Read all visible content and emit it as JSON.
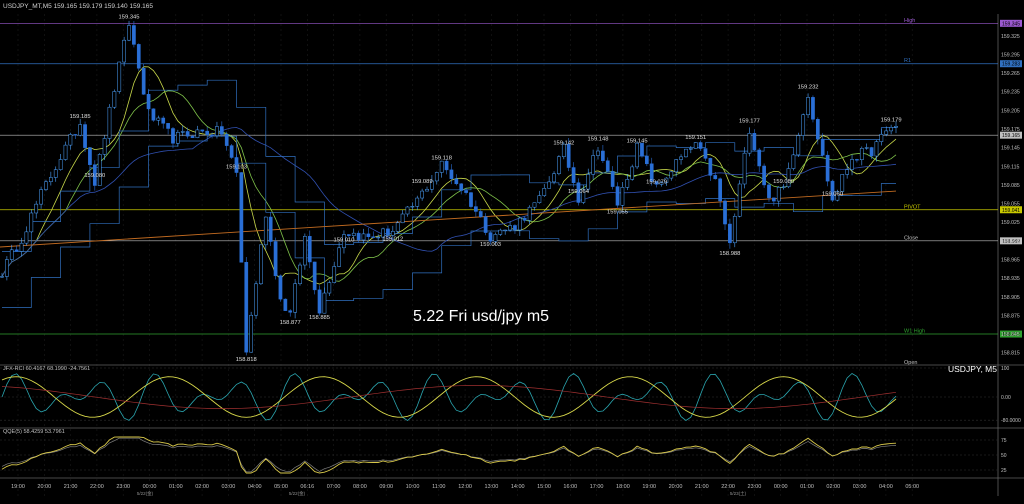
{
  "header": {
    "symbol_info": "USDJPY_MT,M5  159.165 159.179 159.140 159.165"
  },
  "overlay_title": "5.22 Fri usd/jpy m5",
  "colors": {
    "background": "#000000",
    "bull": "#4da3ff",
    "bear": "#2a6fd6",
    "ma_green": "#7fc24a",
    "ma_yellow": "#c8d84a",
    "ma_blue": "#3050b0",
    "trend_orange": "#c06a20",
    "level_purple": "#9b59d0",
    "level_blue": "#3070c0",
    "level_yellow": "#c8c800",
    "level_green": "#2fa02f",
    "level_white": "#c0c0c0",
    "osc_yellow": "#d8d84a",
    "osc_cyan": "#2aa6b0",
    "osc_red": "#a03030",
    "qqe_yellow": "#d8c84a",
    "qqe_gray": "#808080"
  },
  "chart_data": {
    "type": "candlestick",
    "symbol": "USDJPY",
    "timeframe": "M5",
    "ylim": [
      158.8,
      159.36
    ],
    "y_ticks": [
      "159.325",
      "159.295",
      "159.265",
      "159.235",
      "159.205",
      "159.175",
      "159.145",
      "159.115",
      "159.085",
      "159.055",
      "159.025",
      "158.995",
      "158.965",
      "158.935",
      "158.905",
      "158.875",
      "158.845",
      "158.815"
    ],
    "x_ticks": [
      "19:00",
      "20:00",
      "21:00",
      "22:00",
      "23:00",
      "00:00",
      "01:00",
      "02:00",
      "03:00",
      "04:00",
      "05:00",
      "06:16",
      "07:00",
      "08:00",
      "09:00",
      "10:00",
      "11:00",
      "12:00",
      "13:00",
      "14:00",
      "15:00",
      "16:00",
      "17:00",
      "18:00",
      "19:00",
      "20:00",
      "21:00",
      "22:00",
      "23:00",
      "00:00",
      "01:00",
      "02:00",
      "03:00",
      "04:00",
      "05:00"
    ],
    "date_labels": [
      "5/22(金)",
      "5/22(金)",
      "5/23(土)"
    ],
    "price_anchors": [
      {
        "t": 0,
        "p": 158.945
      },
      {
        "t": 4,
        "p": 159.0
      },
      {
        "t": 8,
        "p": 159.07
      },
      {
        "t": 12,
        "p": 159.13
      },
      {
        "t": 16,
        "p": 159.185
      },
      {
        "t": 19,
        "p": 159.09
      },
      {
        "t": 23,
        "p": 159.24
      },
      {
        "t": 26,
        "p": 159.345
      },
      {
        "t": 30,
        "p": 159.2
      },
      {
        "t": 35,
        "p": 159.16
      },
      {
        "t": 40,
        "p": 159.17
      },
      {
        "t": 45,
        "p": 159.17
      },
      {
        "t": 48,
        "p": 159.103
      },
      {
        "t": 50,
        "p": 158.818
      },
      {
        "t": 54,
        "p": 159.04
      },
      {
        "t": 57,
        "p": 158.9
      },
      {
        "t": 59,
        "p": 158.877
      },
      {
        "t": 62,
        "p": 159.0
      },
      {
        "t": 65,
        "p": 158.885
      },
      {
        "t": 70,
        "p": 159.01
      },
      {
        "t": 75,
        "p": 159.0
      },
      {
        "t": 80,
        "p": 159.012
      },
      {
        "t": 85,
        "p": 159.06
      },
      {
        "t": 90,
        "p": 159.118
      },
      {
        "t": 95,
        "p": 159.07
      },
      {
        "t": 100,
        "p": 159.003
      },
      {
        "t": 105,
        "p": 159.02
      },
      {
        "t": 110,
        "p": 159.06
      },
      {
        "t": 115,
        "p": 159.142
      },
      {
        "t": 118,
        "p": 159.064
      },
      {
        "t": 122,
        "p": 159.148
      },
      {
        "t": 126,
        "p": 159.055
      },
      {
        "t": 130,
        "p": 159.145
      },
      {
        "t": 134,
        "p": 159.079
      },
      {
        "t": 138,
        "p": 159.12
      },
      {
        "t": 142,
        "p": 159.151
      },
      {
        "t": 146,
        "p": 159.09
      },
      {
        "t": 149,
        "p": 158.988
      },
      {
        "t": 153,
        "p": 159.177
      },
      {
        "t": 157,
        "p": 159.06
      },
      {
        "t": 160,
        "p": 159.08
      },
      {
        "t": 165,
        "p": 159.232
      },
      {
        "t": 170,
        "p": 159.06
      },
      {
        "t": 174,
        "p": 159.13
      },
      {
        "t": 178,
        "p": 159.14
      },
      {
        "t": 182,
        "p": 159.179
      }
    ],
    "annotations": [
      {
        "label": "159.345",
        "t": 26,
        "p": 159.345
      },
      {
        "label": "159.185",
        "t": 16,
        "p": 159.185
      },
      {
        "label": "159.080",
        "t": 19,
        "p": 159.09
      },
      {
        "label": "159.103",
        "t": 48,
        "p": 159.103
      },
      {
        "label": "158.818",
        "t": 50,
        "p": 158.818
      },
      {
        "label": "158.877",
        "t": 59,
        "p": 158.877
      },
      {
        "label": "158.885",
        "t": 65,
        "p": 158.885
      },
      {
        "label": "159.010",
        "t": 70,
        "p": 159.01
      },
      {
        "label": "159.012",
        "t": 80,
        "p": 159.012
      },
      {
        "label": "159.118",
        "t": 90,
        "p": 159.118
      },
      {
        "label": "159.089",
        "t": 86,
        "p": 159.08
      },
      {
        "label": "159.003",
        "t": 100,
        "p": 159.003
      },
      {
        "label": "159.142",
        "t": 115,
        "p": 159.142
      },
      {
        "label": "159.064",
        "t": 118,
        "p": 159.064
      },
      {
        "label": "159.148",
        "t": 122,
        "p": 159.148
      },
      {
        "label": "159.055",
        "t": 126,
        "p": 159.055
      },
      {
        "label": "159.145",
        "t": 130,
        "p": 159.145
      },
      {
        "label": "159.079",
        "t": 134,
        "p": 159.079
      },
      {
        "label": "159.151",
        "t": 142,
        "p": 159.151
      },
      {
        "label": "158.988",
        "t": 149,
        "p": 158.988
      },
      {
        "label": "159.177",
        "t": 153,
        "p": 159.177
      },
      {
        "label": "159.080",
        "t": 160,
        "p": 159.08
      },
      {
        "label": "159.232",
        "t": 165,
        "p": 159.232
      },
      {
        "label": "159.060",
        "t": 170,
        "p": 159.06
      },
      {
        "label": "159.179",
        "t": 182,
        "p": 159.179
      }
    ],
    "levels": [
      {
        "name": "High",
        "price": 159.345,
        "color_key": "level_purple",
        "tag": "159.345"
      },
      {
        "name": "R1",
        "price": 159.28,
        "color_key": "level_blue",
        "tag": "159.283"
      },
      {
        "name": "PIVOT",
        "price": 159.045,
        "color_key": "level_yellow",
        "tag": "159.041"
      },
      {
        "name": "Close",
        "price": 158.995,
        "color_key": "level_white",
        "tag": "158.989"
      },
      {
        "name": "W1 High",
        "price": 158.845,
        "color_key": "level_green",
        "tag": "158.843"
      },
      {
        "name": "",
        "price": 159.165,
        "color_key": "level_white",
        "tag": "159.165"
      }
    ],
    "open_label": "Open",
    "oscillator": {
      "label": "JFX-RCI 60.4167 68.1990 -24.7561",
      "instrument_label": "USDJPY, M5",
      "y_ticks": [
        "100",
        "0.00",
        "-80.0000"
      ]
    },
    "qqe": {
      "label": "QQE(5) 58.4259 53.7961",
      "y_ticks": [
        "75",
        "50",
        "25"
      ]
    }
  }
}
